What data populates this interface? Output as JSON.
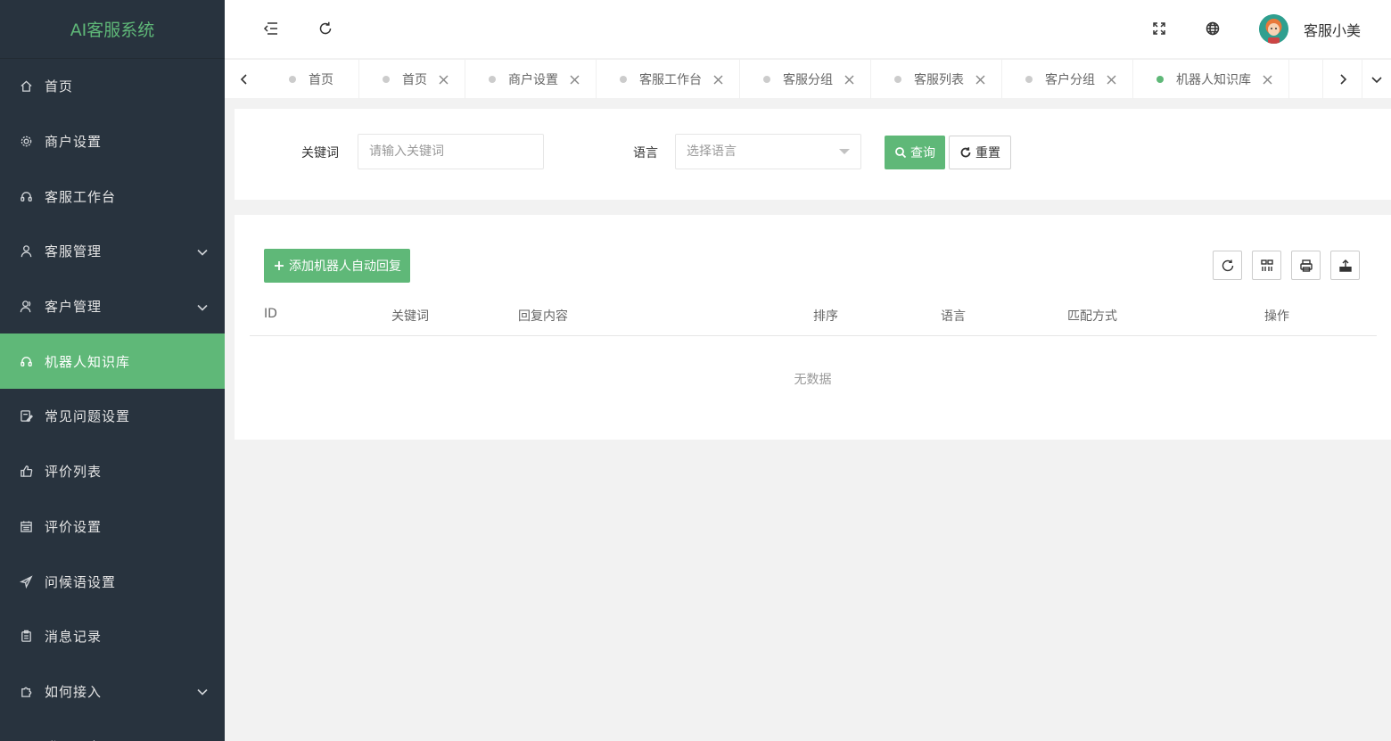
{
  "app": {
    "title": "AI客服系统"
  },
  "sidebar": {
    "items": [
      {
        "label": "首页",
        "icon": "home-icon",
        "active": false,
        "has_children": false
      },
      {
        "label": "商户设置",
        "icon": "gear-icon",
        "active": false,
        "has_children": false
      },
      {
        "label": "客服工作台",
        "icon": "headset-icon",
        "active": false,
        "has_children": false
      },
      {
        "label": "客服管理",
        "icon": "user-icon",
        "active": false,
        "has_children": true
      },
      {
        "label": "客户管理",
        "icon": "users-icon",
        "active": false,
        "has_children": true
      },
      {
        "label": "机器人知识库",
        "icon": "headset-icon",
        "active": true,
        "has_children": false
      },
      {
        "label": "常见问题设置",
        "icon": "edit-icon",
        "active": false,
        "has_children": false
      },
      {
        "label": "评价列表",
        "icon": "thumbs-up-icon",
        "active": false,
        "has_children": false
      },
      {
        "label": "评价设置",
        "icon": "calendar-icon",
        "active": false,
        "has_children": false
      },
      {
        "label": "问候语设置",
        "icon": "send-icon",
        "active": false,
        "has_children": false
      },
      {
        "label": "消息记录",
        "icon": "clipboard-icon",
        "active": false,
        "has_children": false
      },
      {
        "label": "如何接入",
        "icon": "puzzle-icon",
        "active": false,
        "has_children": true
      },
      {
        "label": "登录日志",
        "icon": "log-icon",
        "active": false,
        "has_children": false
      }
    ]
  },
  "header": {
    "user_name": "客服小美"
  },
  "tabs": [
    {
      "label": "首页",
      "closable": false,
      "active": false
    },
    {
      "label": "首页",
      "closable": true,
      "active": false
    },
    {
      "label": "商户设置",
      "closable": true,
      "active": false
    },
    {
      "label": "客服工作台",
      "closable": true,
      "active": false
    },
    {
      "label": "客服分组",
      "closable": true,
      "active": false
    },
    {
      "label": "客服列表",
      "closable": true,
      "active": false
    },
    {
      "label": "客户分组",
      "closable": true,
      "active": false
    },
    {
      "label": "机器人知识库",
      "closable": true,
      "active": true
    }
  ],
  "search": {
    "keyword_label": "关键词",
    "keyword_placeholder": "请输入关键词",
    "language_label": "语言",
    "language_placeholder": "选择语言",
    "query_label": "查询",
    "reset_label": "重置"
  },
  "table": {
    "add_label": "添加机器人自动回复",
    "columns": [
      "ID",
      "关键词",
      "回复内容",
      "排序",
      "语言",
      "匹配方式",
      "操作"
    ],
    "rows": [],
    "empty_text": "无数据"
  },
  "colors": {
    "accent": "#5fb878",
    "sidebar_bg": "#28333e"
  }
}
